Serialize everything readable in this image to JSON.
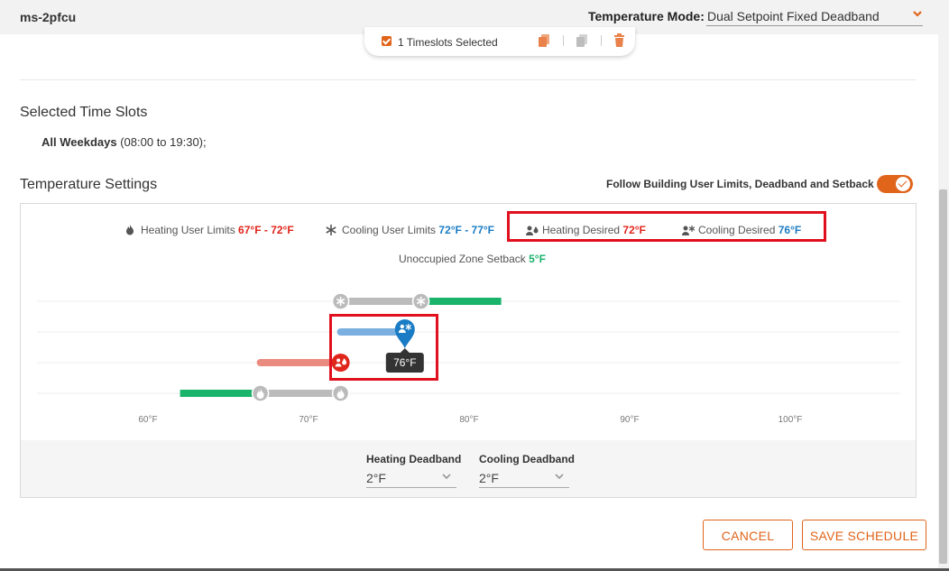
{
  "header": {
    "zone_name": "ms-2pfcu",
    "mode_label": "Temperature Mode:",
    "mode_value": "Dual Setpoint Fixed Deadband"
  },
  "timeslot_bar": {
    "selected_label": "1 Timeslots Selected",
    "checked": true,
    "icons": [
      "copy-icon",
      "paste-icon",
      "trash-icon"
    ]
  },
  "selected_time_slots": {
    "title": "Selected Time Slots",
    "days": "All Weekdays",
    "time_range": "(08:00 to 19:30);"
  },
  "temperature_settings": {
    "title": "Temperature Settings",
    "follow_label": "Follow Building User Limits, Deadband and Setback",
    "follow_enabled": true
  },
  "legend": {
    "heating_limits_label": "Heating User Limits",
    "heating_limits_value": "67°F - 72°F",
    "cooling_limits_label": "Cooling User Limits",
    "cooling_limits_value": "72°F - 77°F",
    "heating_desired_label": "Heating Desired",
    "heating_desired_value": "72°F",
    "cooling_desired_label": "Cooling Desired",
    "cooling_desired_value": "76°F",
    "setback_label": "Unoccupied Zone Setback",
    "setback_value": "5°F"
  },
  "slider": {
    "axis_ticks": [
      "60°F",
      "70°F",
      "80°F",
      "90°F",
      "100°F"
    ],
    "axis_min": 60,
    "axis_max": 100,
    "cooling_limits": [
      72,
      77
    ],
    "heating_limits": [
      67,
      72
    ],
    "cooling_desired": 76,
    "heating_desired": 72,
    "tooltip": "76°F"
  },
  "deadband": {
    "heating_label": "Heating Deadband",
    "heating_value": "2°F",
    "cooling_label": "Cooling Deadband",
    "cooling_value": "2°F"
  },
  "buttons": {
    "cancel": "CANCEL",
    "save": "SAVE SCHEDULE"
  },
  "colors": {
    "accent": "#e0641a",
    "heat": "#e0251b",
    "cool": "#1a7cc4",
    "setback": "#1ab36b",
    "limit_track": "#bbbbbb"
  }
}
